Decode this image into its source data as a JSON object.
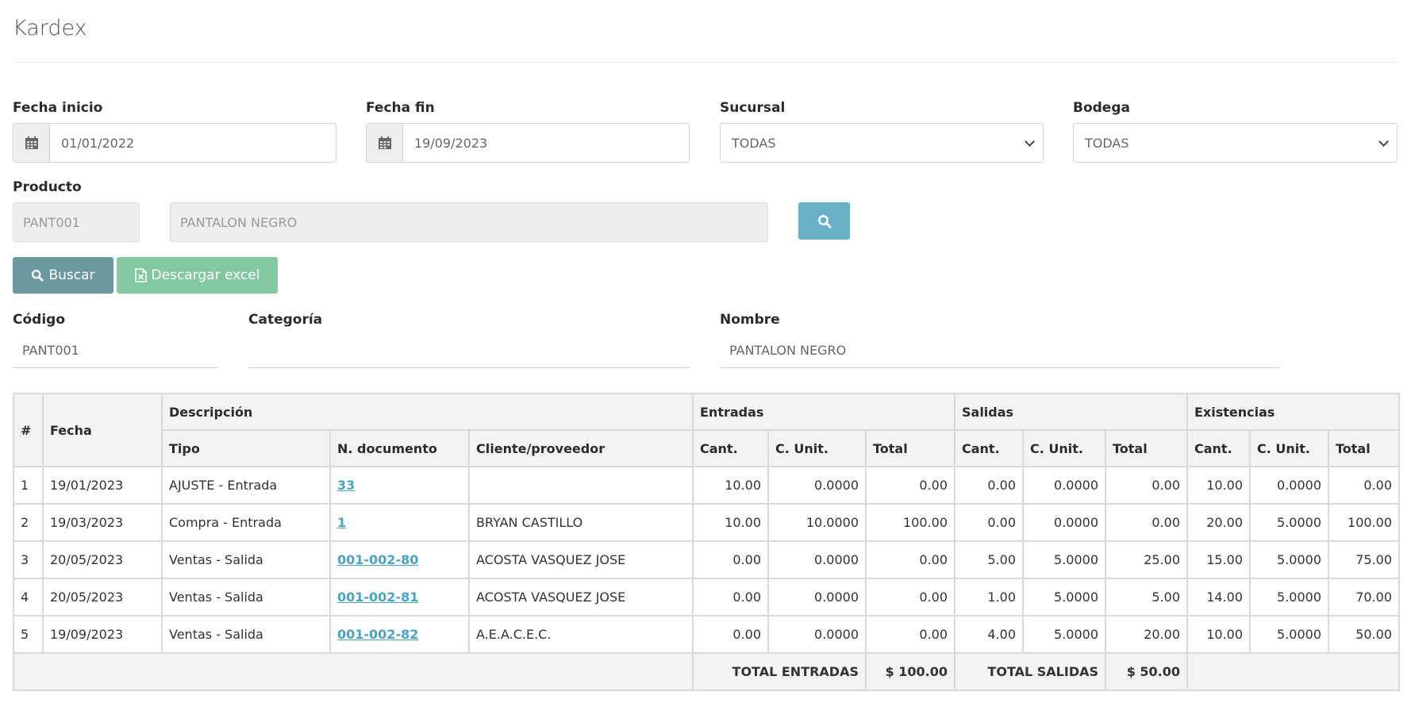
{
  "page": {
    "title": "Kardex"
  },
  "filters": {
    "fecha_inicio": {
      "label": "Fecha inicio",
      "value": "01/01/2022"
    },
    "fecha_fin": {
      "label": "Fecha fin",
      "value": "19/09/2023"
    },
    "sucursal": {
      "label": "Sucursal",
      "value": "TODAS"
    },
    "bodega": {
      "label": "Bodega",
      "value": "TODAS"
    },
    "producto": {
      "label": "Producto",
      "code": "PANT001",
      "name": "PANTALON NEGRO"
    }
  },
  "buttons": {
    "buscar": "Buscar",
    "excel": "Descargar excel"
  },
  "product_info": {
    "codigo": {
      "label": "Código",
      "value": "PANT001"
    },
    "categoria": {
      "label": "Categoría",
      "value": ""
    },
    "nombre": {
      "label": "Nombre",
      "value": "PANTALON NEGRO"
    }
  },
  "table": {
    "headers": {
      "num": "#",
      "fecha": "Fecha",
      "descripcion": "Descripción",
      "entradas": "Entradas",
      "salidas": "Salidas",
      "existencias": "Existencias",
      "tipo": "Tipo",
      "documento": "N. documento",
      "cliente": "Cliente/proveedor",
      "cant": "Cant.",
      "cunit": "C. Unit.",
      "total": "Total"
    },
    "rows": [
      {
        "num": "1",
        "fecha": "19/01/2023",
        "tipo": "AJUSTE - Entrada",
        "documento": "33",
        "cliente": "",
        "e_cant": "10.00",
        "e_cunit": "0.0000",
        "e_total": "0.00",
        "s_cant": "0.00",
        "s_cunit": "0.0000",
        "s_total": "0.00",
        "x_cant": "10.00",
        "x_cunit": "0.0000",
        "x_total": "0.00"
      },
      {
        "num": "2",
        "fecha": "19/03/2023",
        "tipo": "Compra - Entrada",
        "documento": "1",
        "cliente": "BRYAN CASTILLO",
        "e_cant": "10.00",
        "e_cunit": "10.0000",
        "e_total": "100.00",
        "s_cant": "0.00",
        "s_cunit": "0.0000",
        "s_total": "0.00",
        "x_cant": "20.00",
        "x_cunit": "5.0000",
        "x_total": "100.00"
      },
      {
        "num": "3",
        "fecha": "20/05/2023",
        "tipo": "Ventas - Salida",
        "documento": "001-002-80",
        "cliente": "ACOSTA VASQUEZ JOSE",
        "e_cant": "0.00",
        "e_cunit": "0.0000",
        "e_total": "0.00",
        "s_cant": "5.00",
        "s_cunit": "5.0000",
        "s_total": "25.00",
        "x_cant": "15.00",
        "x_cunit": "5.0000",
        "x_total": "75.00"
      },
      {
        "num": "4",
        "fecha": "20/05/2023",
        "tipo": "Ventas - Salida",
        "documento": "001-002-81",
        "cliente": "ACOSTA VASQUEZ JOSE",
        "e_cant": "0.00",
        "e_cunit": "0.0000",
        "e_total": "0.00",
        "s_cant": "1.00",
        "s_cunit": "5.0000",
        "s_total": "5.00",
        "x_cant": "14.00",
        "x_cunit": "5.0000",
        "x_total": "70.00"
      },
      {
        "num": "5",
        "fecha": "19/09/2023",
        "tipo": "Ventas - Salida",
        "documento": "001-002-82",
        "cliente": "A.E.A.C.E.C.",
        "e_cant": "0.00",
        "e_cunit": "0.0000",
        "e_total": "0.00",
        "s_cant": "4.00",
        "s_cunit": "5.0000",
        "s_total": "20.00",
        "x_cant": "10.00",
        "x_cunit": "5.0000",
        "x_total": "50.00"
      }
    ],
    "footer": {
      "total_entradas_label": "TOTAL ENTRADAS",
      "total_entradas": "$ 100.00",
      "total_salidas_label": "TOTAL SALIDAS",
      "total_salidas": "$ 50.00"
    }
  }
}
